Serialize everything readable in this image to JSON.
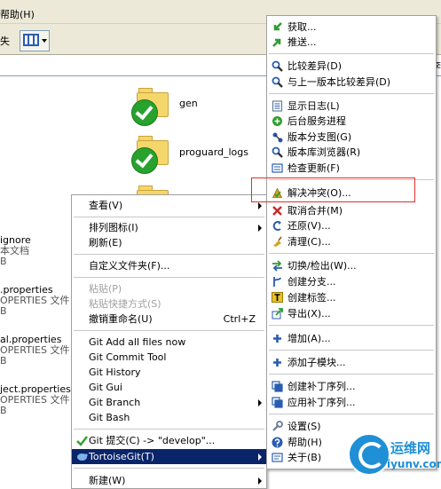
{
  "window": {
    "menu_help": "帮助(H)",
    "toolbar_fragment": "失",
    "address_right": "芳李"
  },
  "folders": [
    {
      "name": "gen"
    },
    {
      "name": "proguard_logs"
    }
  ],
  "left_files": [
    {
      "name": "ignore",
      "type": "本文档",
      "size": "B"
    },
    {
      "name": ".properties",
      "type": "OPERTIES 文件",
      "size": "B"
    },
    {
      "name": "al.properties",
      "type": "OPERTIES 文件",
      "size": "B"
    },
    {
      "name": "ject.properties",
      "type": "OPERTIES 文件",
      "size": "B"
    }
  ],
  "context_menu": {
    "items": [
      {
        "label": "查看(V)",
        "submenu": true
      },
      {
        "label": "排列图标(I)",
        "submenu": true
      },
      {
        "label": "刷新(E)"
      },
      {
        "label": "自定义文件夹(F)..."
      },
      {
        "label": "粘贴(P)",
        "disabled": true
      },
      {
        "label": "粘贴快捷方式(S)",
        "disabled": true
      },
      {
        "label": "撤销重命名(U)",
        "shortcut": "Ctrl+Z"
      },
      {
        "label": "Git Add all files now"
      },
      {
        "label": "Git Commit Tool"
      },
      {
        "label": "Git History"
      },
      {
        "label": "Git Gui"
      },
      {
        "label": "Git Branch",
        "submenu": true
      },
      {
        "label": "Git Bash"
      },
      {
        "label": "Git 提交(C) -> \"develop\"..."
      },
      {
        "label": "TortoiseGit(T)",
        "submenu": true,
        "selected": true
      },
      {
        "label": "新建(W)",
        "submenu": true
      }
    ]
  },
  "tortoise_menu": {
    "items": [
      {
        "label": "获取...",
        "icon": "fetch-icon",
        "color": "#2f9e2f"
      },
      {
        "label": "推送...",
        "icon": "push-icon",
        "color": "#2f9e2f"
      },
      {
        "label": "比较差异(D)",
        "icon": "diff-icon",
        "color": "#2a5db0"
      },
      {
        "label": "与上一版本比较差异(D)",
        "icon": "diff-previous-icon",
        "color": "#2a5db0"
      },
      {
        "label": "显示日志(L)",
        "icon": "log-icon",
        "color": "#6a7c95"
      },
      {
        "label": "后台服务进程",
        "icon": "daemon-icon",
        "color": "#2f9e2f"
      },
      {
        "label": "版本分支图(G)",
        "icon": "revision-graph-icon",
        "color": "#2a5db0"
      },
      {
        "label": "版本库浏览器(R)",
        "icon": "repo-browser-icon",
        "color": "#2a5db0"
      },
      {
        "label": "检查更新(F)",
        "icon": "check-updates-icon",
        "color": "#2a5db0"
      },
      {
        "label": "解决冲突(O)...",
        "icon": "resolve-icon",
        "color": "#d8a21f"
      },
      {
        "label": "取消合并(M)",
        "icon": "abort-merge-icon",
        "color": "#c62828"
      },
      {
        "label": "还原(V)...",
        "icon": "revert-icon",
        "color": "#2a5db0"
      },
      {
        "label": "清理(C)...",
        "icon": "cleanup-icon",
        "color": "#d8a21f"
      },
      {
        "label": "切换/检出(W)...",
        "icon": "switch-icon",
        "color": "#2f9e2f"
      },
      {
        "label": "创建分支...",
        "icon": "branch-icon",
        "color": "#2a5db0"
      },
      {
        "label": "创建标签...",
        "icon": "tag-icon",
        "color": "#e8c22a"
      },
      {
        "label": "导出(X)...",
        "icon": "export-icon",
        "color": "#2f9e2f"
      },
      {
        "label": "增加(A)...",
        "icon": "add-icon",
        "color": "#2a5db0"
      },
      {
        "label": "添加子模块...",
        "icon": "submodule-icon",
        "color": "#2a5db0"
      },
      {
        "label": "创建补丁序列...",
        "icon": "create-patch-icon",
        "color": "#2a5db0"
      },
      {
        "label": "应用补丁序列...",
        "icon": "apply-patch-icon",
        "color": "#2a5db0"
      },
      {
        "label": "设置(S)",
        "icon": "settings-icon",
        "color": "#6a7c95"
      },
      {
        "label": "帮助(H)",
        "icon": "help-icon",
        "color": "#2a5db0"
      },
      {
        "label": "关于(B)",
        "icon": "about-icon",
        "color": "#2a5db0"
      }
    ]
  },
  "watermark": {
    "title": "运维网",
    "url": "iyunv.com"
  }
}
